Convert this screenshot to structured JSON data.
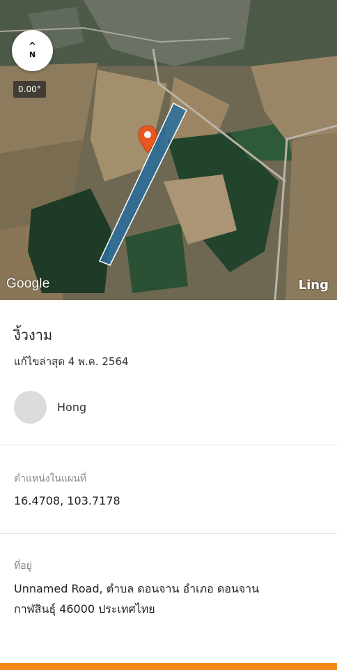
{
  "map": {
    "compass_arrow": "^",
    "compass_letter": "N",
    "heading": "0.00°",
    "attribution": "Google",
    "layer_name": "Ling",
    "colors": {
      "plot_fill": "#2a6f9e",
      "plot_stroke": "#ffffff",
      "pin": "#e8571f"
    },
    "icons": [
      "compass-icon",
      "location-pin-icon"
    ]
  },
  "place": {
    "title": "งิ้วงาม",
    "updated": "แก้ไขล่าสุด 4 พ.ค. 2564"
  },
  "owner": {
    "name": "Hong"
  },
  "location": {
    "label": "ตำแหน่งในแผนที่",
    "value": "16.4708, 103.7178"
  },
  "address": {
    "label": "ที่อยู่",
    "line1": "Unnamed Road, ตำบล ดอนจาน อำเภอ ดอนจาน",
    "line2": "กาฬสินธุ์ 46000 ประเทศไทย"
  },
  "accent_color": "#f38a18"
}
